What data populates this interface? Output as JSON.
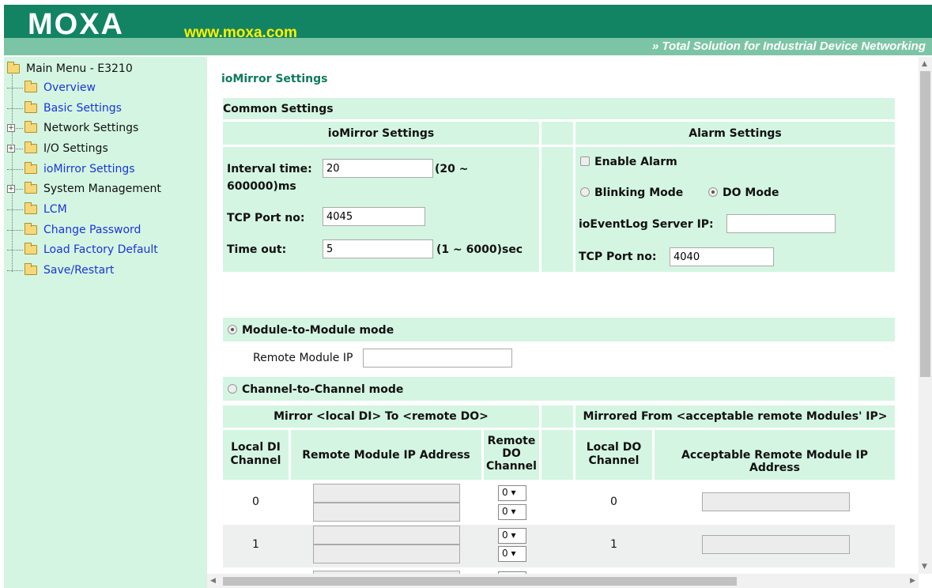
{
  "header": {
    "logo": "MOXA",
    "site": "www.moxa.com",
    "tagline": "» Total Solution for Industrial Device Networking"
  },
  "sidebar": {
    "root": "Main Menu - E3210",
    "items": [
      {
        "label": "Overview",
        "expandable": false,
        "link": true
      },
      {
        "label": "Basic Settings",
        "expandable": false,
        "link": true
      },
      {
        "label": "Network Settings",
        "expandable": true,
        "link": false
      },
      {
        "label": "I/O Settings",
        "expandable": true,
        "link": false
      },
      {
        "label": "ioMirror Settings",
        "expandable": false,
        "link": true
      },
      {
        "label": "System Management",
        "expandable": true,
        "link": false
      },
      {
        "label": "LCM",
        "expandable": false,
        "link": true
      },
      {
        "label": "Change Password",
        "expandable": false,
        "link": true
      },
      {
        "label": "Load Factory Default",
        "expandable": false,
        "link": true
      },
      {
        "label": "Save/Restart",
        "expandable": false,
        "link": true
      }
    ]
  },
  "page": {
    "title": "ioMirror Settings",
    "common_settings": "Common Settings",
    "iomirror": {
      "heading": "ioMirror Settings",
      "interval_label": "Interval time:",
      "interval_value": "20",
      "interval_range_a": "(20 ~",
      "interval_range_b": "600000)ms",
      "tcp_label": "TCP Port no:",
      "tcp_value": "4045",
      "timeout_label": "Time out:",
      "timeout_value": "5",
      "timeout_range": "(1 ~ 6000)sec"
    },
    "alarm": {
      "heading": "Alarm Settings",
      "enable_label": "Enable Alarm",
      "blinking_label": "Blinking Mode",
      "do_mode_label": "DO Mode",
      "server_label": "ioEventLog Server IP:",
      "server_value": "",
      "tcp_label": "TCP Port no:",
      "tcp_value": "4040"
    },
    "module_mode": {
      "label": "Module-to-Module mode",
      "remote_ip_label": "Remote Module IP",
      "remote_ip_value": ""
    },
    "channel_mode": {
      "label": "Channel-to-Channel mode",
      "mirror_heading": "Mirror <local DI> To <remote DO>",
      "mirrored_heading": "Mirrored  From <acceptable remote Modules' IP>",
      "col_local_di": "Local DI Channel",
      "col_remote_ip": "Remote Module IP Address",
      "col_remote_do": "Remote DO Channel",
      "col_local_do": "Local DO Channel",
      "col_accept_ip": "Acceptable Remote Module IP Address",
      "rows": [
        {
          "di": "0",
          "do_sel_a": "0",
          "do_sel_b": "0",
          "local_do": "0"
        },
        {
          "di": "1",
          "do_sel_a": "0",
          "do_sel_b": "0",
          "local_do": "1"
        }
      ]
    }
  }
}
